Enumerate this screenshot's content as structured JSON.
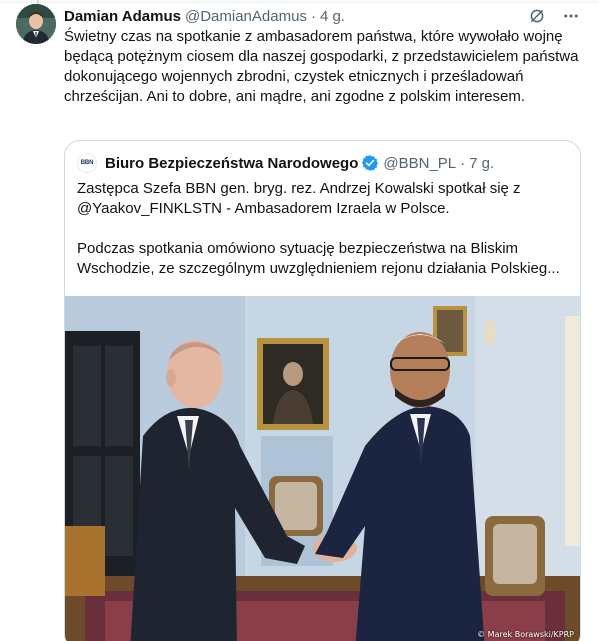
{
  "tweet": {
    "author_name": "Damian Adamus",
    "author_handle": "@DamianAdamus",
    "separator": "·",
    "time": "4 g.",
    "text": "Świetny czas na spotkanie z ambasadorem państwa, które wywołało wojnę będącą potężnym ciosem dla naszej gospodarki, z przedstawicielem państwa dokonującego wojennych zbrodni, czystek etnicznych i prześladowań chrześcijan. Ani to dobre, ani mądre, ani zgodne z polskim interesem."
  },
  "quote": {
    "logo_text": "BBN",
    "author_name": "Biuro Bezpieczeństwa Narodowego",
    "author_handle": "@BBN_PL",
    "separator": "·",
    "time": "7 g.",
    "paragraph_1": "Zastępca Szefa BBN gen. bryg. rez. Andrzej Kowalski spotkał się z @Yaakov_FINKLSTN - Ambasadorem Izraela w Polsce.",
    "paragraph_2_line_1": "Podczas spotkania omówiono sytuację bezpieczeństwa na Bliskim",
    "paragraph_2_line_2": "Wschodzie, ze szczególnym uwzględnieniem rejonu działania Polskieg...",
    "photo_credit": "© Marek Borawski/KPRP"
  },
  "icons": {
    "action_1": "grok-icon",
    "action_2": "more-icon",
    "verified": "verified-badge-icon"
  },
  "colors": {
    "link": "#1d9bf0",
    "secondary_text": "#536471",
    "border": "#cfd9de",
    "verified_blue": "#1d9bf0"
  }
}
